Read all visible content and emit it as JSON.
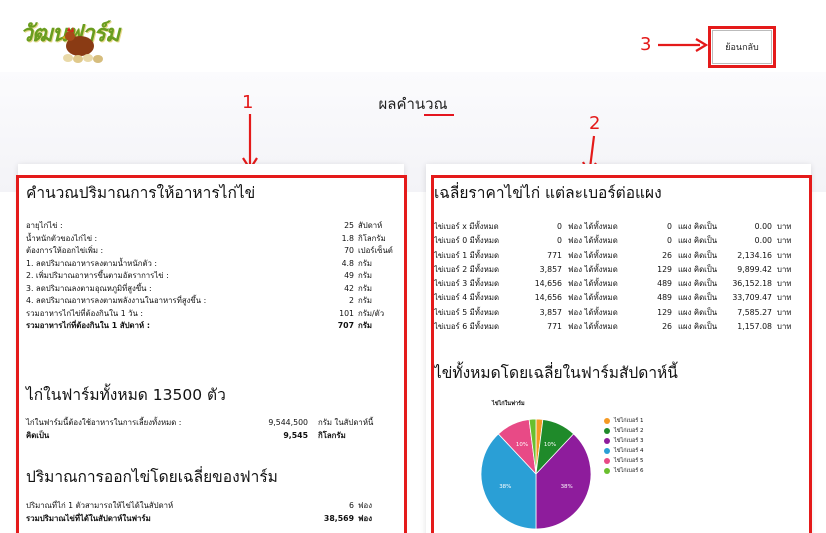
{
  "header": {
    "logo_text": "วัฒนฟาร์ม",
    "back_label": "ย้อนกลับ"
  },
  "annotations": [
    "1",
    "2",
    "3"
  ],
  "page_title": "ผลคำนวณ",
  "feed_card": {
    "title": "คำนวณปริมาณการให้อาหารไก่ไข่",
    "rows": [
      {
        "label": "อายุไก่ไข่ :",
        "value": "25",
        "unit": "สัปดาห์"
      },
      {
        "label": "น้ำหนักตัวของไก่ไข่ :",
        "value": "1.8",
        "unit": "กิโลกรัม"
      },
      {
        "label": "ต้องการให้ออกไข่เพิ่ม :",
        "value": "70",
        "unit": "เปอร์เซ็นต์"
      },
      {
        "label": "1. ลดปริมาณอาหารลงตามน้ำหนักตัว :",
        "value": "4.8",
        "unit": "กรัม"
      },
      {
        "label": "2. เพิ่มปริมาณอาหารขึ้นตามอัตราการไข่ :",
        "value": "49",
        "unit": "กรัม"
      },
      {
        "label": "3. ลดปริมาณลงตามอุณหภูมิที่สูงขึ้น :",
        "value": "42",
        "unit": "กรัม"
      },
      {
        "label": "4. ลดปริมาณอาหารลงตามพลังงานในอาหารที่สูงขึ้น :",
        "value": "2",
        "unit": "กรัม"
      },
      {
        "label": "รวมอาหารไก่ไข่ที่ต้องกินใน 1 วัน :",
        "value": "101",
        "unit": "กรัม/ตัว"
      },
      {
        "label": "รวมอาหารไก่ที่ต้องกินใน 1 สัปดาห์ :",
        "value": "707",
        "unit": "กรัม"
      }
    ]
  },
  "farm_section": {
    "title": "ไก่ในฟาร์มทั้งหมด 13500 ตัว",
    "rows": [
      {
        "label": "ไก่ในฟาร์มนี้ต้องใช้อาหารในการเลี้ยงทั้งหมด :",
        "value": "9,544,500",
        "unit": "กรัม ในสัปดาห์นี้"
      },
      {
        "label": "คิดเป็น",
        "value": "9,545",
        "unit": "กิโลกรัม"
      }
    ]
  },
  "egg_section": {
    "title": "ปริมาณการออกไข่โดยเฉลี่ยของฟาร์ม",
    "rows": [
      {
        "label": "ปริมาณที่ไก่ 1 ตัวสามารถให้ไข่ได้ในสัปดาห์",
        "value": "6",
        "unit": "ฟอง"
      },
      {
        "label": "รวมปริมาณไข่ที่ได้ในสัปดาห์ในฟาร์ม",
        "value": "38,569",
        "unit": "ฟอง"
      }
    ]
  },
  "price_card": {
    "title": "เฉลี่ยราคาไข่ไก่ แต่ละเบอร์ต่อแผง",
    "rows": [
      {
        "name": "ไข่เบอร์ x มีทั้งหมด",
        "eggs": "0",
        "u1": "ฟอง ได้ทั้งหมด",
        "trays": "0",
        "u2": "แผง คิดเป็น",
        "price": "0.00",
        "u3": "บาท"
      },
      {
        "name": "ไข่เบอร์ 0 มีทั้งหมด",
        "eggs": "0",
        "u1": "ฟอง ได้ทั้งหมด",
        "trays": "0",
        "u2": "แผง คิดเป็น",
        "price": "0.00",
        "u3": "บาท"
      },
      {
        "name": "ไข่เบอร์ 1 มีทั้งหมด",
        "eggs": "771",
        "u1": "ฟอง ได้ทั้งหมด",
        "trays": "26",
        "u2": "แผง คิดเป็น",
        "price": "2,134.16",
        "u3": "บาท"
      },
      {
        "name": "ไข่เบอร์ 2 มีทั้งหมด",
        "eggs": "3,857",
        "u1": "ฟอง ได้ทั้งหมด",
        "trays": "129",
        "u2": "แผง คิดเป็น",
        "price": "9,899.42",
        "u3": "บาท"
      },
      {
        "name": "ไข่เบอร์ 3 มีทั้งหมด",
        "eggs": "14,656",
        "u1": "ฟอง ได้ทั้งหมด",
        "trays": "489",
        "u2": "แผง คิดเป็น",
        "price": "36,152.18",
        "u3": "บาท"
      },
      {
        "name": "ไข่เบอร์ 4 มีทั้งหมด",
        "eggs": "14,656",
        "u1": "ฟอง ได้ทั้งหมด",
        "trays": "489",
        "u2": "แผง คิดเป็น",
        "price": "33,709.47",
        "u3": "บาท"
      },
      {
        "name": "ไข่เบอร์ 5 มีทั้งหมด",
        "eggs": "3,857",
        "u1": "ฟอง ได้ทั้งหมด",
        "trays": "129",
        "u2": "แผง คิดเป็น",
        "price": "7,585.27",
        "u3": "บาท"
      },
      {
        "name": "ไข่เบอร์ 6 มีทั้งหมด",
        "eggs": "771",
        "u1": "ฟอง ได้ทั้งหมด",
        "trays": "26",
        "u2": "แผง คิดเป็น",
        "price": "1,157.08",
        "u3": "บาท"
      }
    ]
  },
  "avg_section": {
    "title": "ไข่ทั้งหมดโดยเฉลี่ยในฟาร์มสัปดาห์นี้"
  },
  "chart_data": {
    "type": "pie",
    "title": "ไข่ไก่ในฟาร์ม",
    "categories": [
      "ไข่ไก่เบอร์ 1",
      "ไข่ไก่เบอร์ 2",
      "ไข่ไก่เบอร์ 3",
      "ไข่ไก่เบอร์ 4",
      "ไข่ไก่เบอร์ 5",
      "ไข่ไก่เบอร์ 6"
    ],
    "values": [
      771,
      3857,
      14656,
      14656,
      3857,
      771
    ],
    "labels": [
      "",
      "10%",
      "38%",
      "38%",
      "10%",
      ""
    ],
    "colors": [
      "#f59a23",
      "#1f8a2a",
      "#8e1c9c",
      "#2a9fd6",
      "#e84a86",
      "#6abf2e"
    ],
    "legend_position": "right"
  }
}
